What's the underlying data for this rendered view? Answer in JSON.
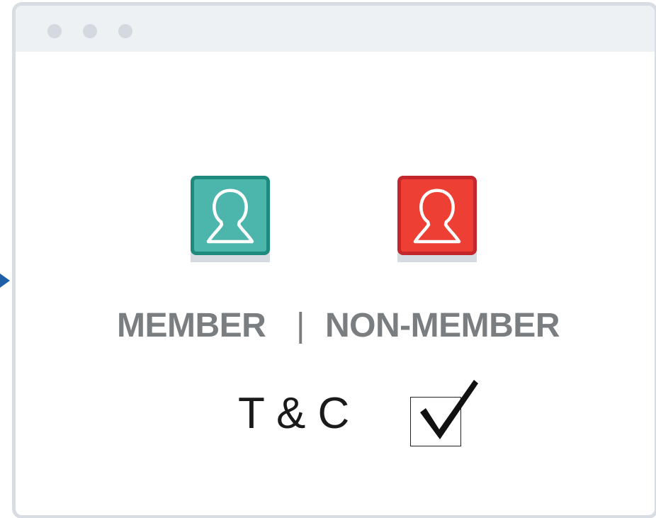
{
  "window": {
    "titlebar_dots": [
      "window-dot-1",
      "window-dot-2",
      "window-dot-3"
    ]
  },
  "icons": {
    "member": "user-icon",
    "non_member": "user-icon",
    "checkmark": "checkmark-icon",
    "pointer": "arrow-right-icon"
  },
  "colors": {
    "member_fill": "#4db6ac",
    "member_border": "#1e8a7e",
    "non_member_fill": "#ee3f35",
    "non_member_border": "#c4272b",
    "label_gray": "#7b7e81",
    "arrow_blue": "#1f5fa8"
  },
  "roles": {
    "member_label": "MEMBER",
    "separator": "|",
    "non_member_label": "NON-MEMBER"
  },
  "terms": {
    "label": "T & C",
    "checked": true
  }
}
